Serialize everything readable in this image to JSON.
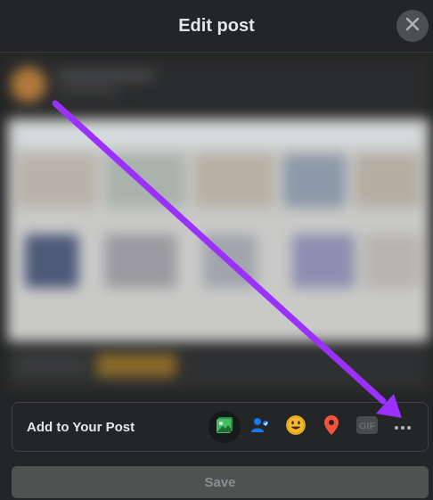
{
  "header": {
    "title": "Edit post"
  },
  "add_to_post": {
    "label": "Add to Your Post",
    "icons": [
      "photo-video-icon",
      "tag-people-icon",
      "feeling-activity-icon",
      "check-in-icon",
      "gif-icon",
      "more-options-icon"
    ]
  },
  "footer": {
    "save_label": "Save"
  },
  "colors": {
    "background": "#242526",
    "arrow": "#9b30ff",
    "photo_green": "#45bd62",
    "tag_blue": "#1877f2",
    "feeling_yellow": "#f7b928",
    "checkin_red": "#f5533d"
  }
}
